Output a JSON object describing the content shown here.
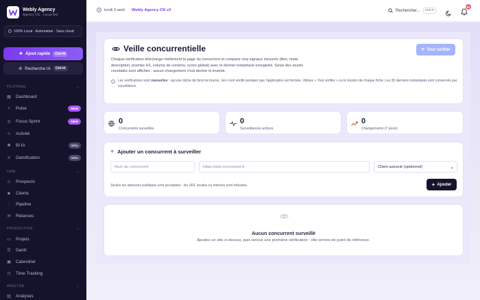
{
  "brand": {
    "name": "Webly Agency",
    "subtitle": "Agency OS · Local-first",
    "logo_letter": "W"
  },
  "sidebar": {
    "local_badge": "100% Local · Automatisé · Sans cloud",
    "quick_add": {
      "label": "Ajout rapide",
      "shortcut": "Ctrl+N"
    },
    "ai_search": {
      "label": "Recherche IA",
      "shortcut": "Ctrl+K"
    },
    "sections": {
      "pilotage": "PILOTAGE",
      "crm": "CRM",
      "production": "PRODUCTION",
      "analyse": "ANALYSE"
    },
    "items": {
      "dashboard": "Dashboard",
      "pulse": "Pulse",
      "focus": "Focus Sprint",
      "activite": "Activité",
      "bi": "BI IA",
      "gamification": "Gamification",
      "prospects": "Prospects",
      "clients": "Clients",
      "pipeline": "Pipeline",
      "relances": "Relances",
      "projets": "Projets",
      "gantt": "Gantt",
      "calendrier": "Calendrier",
      "time": "Time Tracking",
      "analyses": "Analyses"
    },
    "badges": {
      "new": "NEW",
      "beta": "Bêta"
    }
  },
  "header": {
    "date": "lundi 3 août",
    "separator": "·",
    "app": "Webly Agency OS v3",
    "search_label": "Rechercher...",
    "search_shortcut": "Ctrl+K",
    "notifications": "9+"
  },
  "intro": {
    "title": "Veille concurrentielle",
    "description": "Chaque vérification télécharge réellement la page du concurrent et compare cinq signaux mesurés (titre, meta description, premier H1, volume de contenu, score global) avec le dernier instantané enregistré. Seuls des écarts constatés sont affichés : aucun changement n'est deviné ni inventé.",
    "note_prefix": "Les vérifications sont ",
    "note_bold": "manuelles",
    "note_suffix": " : aucune tâche de fond ne tourne, rien n'est vérifié pendant que l'application est fermée. Utilisez « Tout vérifier » ou le bouton de chaque fiche. Les 30 derniers instantanés sont conservés par surveillance.",
    "verify_all": "Tout vérifier"
  },
  "stats": [
    {
      "value": "0",
      "label": "Concurrents surveillés",
      "icon": "globe-icon"
    },
    {
      "value": "0",
      "label": "Surveillances actives",
      "icon": "activity-icon"
    },
    {
      "value": "0",
      "label": "Changements (7 jours)",
      "icon": "trend-icon"
    }
  ],
  "add_form": {
    "title": "Ajouter un concurrent à surveiller",
    "name_placeholder": "Nom du concurrent",
    "url_placeholder": "https://site-concurrent.fr",
    "client_select": "Client associé (optionnel)",
    "hint": "Seules les adresses publiques sont acceptées : les URL locales ou internes sont refusées.",
    "submit": "Ajouter"
  },
  "empty_state": {
    "title": "Aucun concurrent surveillé",
    "description": "Ajoutez un site ci-dessus, puis lancez une première vérification : elle servira de point de référence."
  },
  "colors": {
    "accent": "#7c3aed",
    "sidebar_bg": "#15132b",
    "verify_button": "#a5b4fc",
    "badge_new": "#a855f7",
    "notification": "#f0617a"
  }
}
